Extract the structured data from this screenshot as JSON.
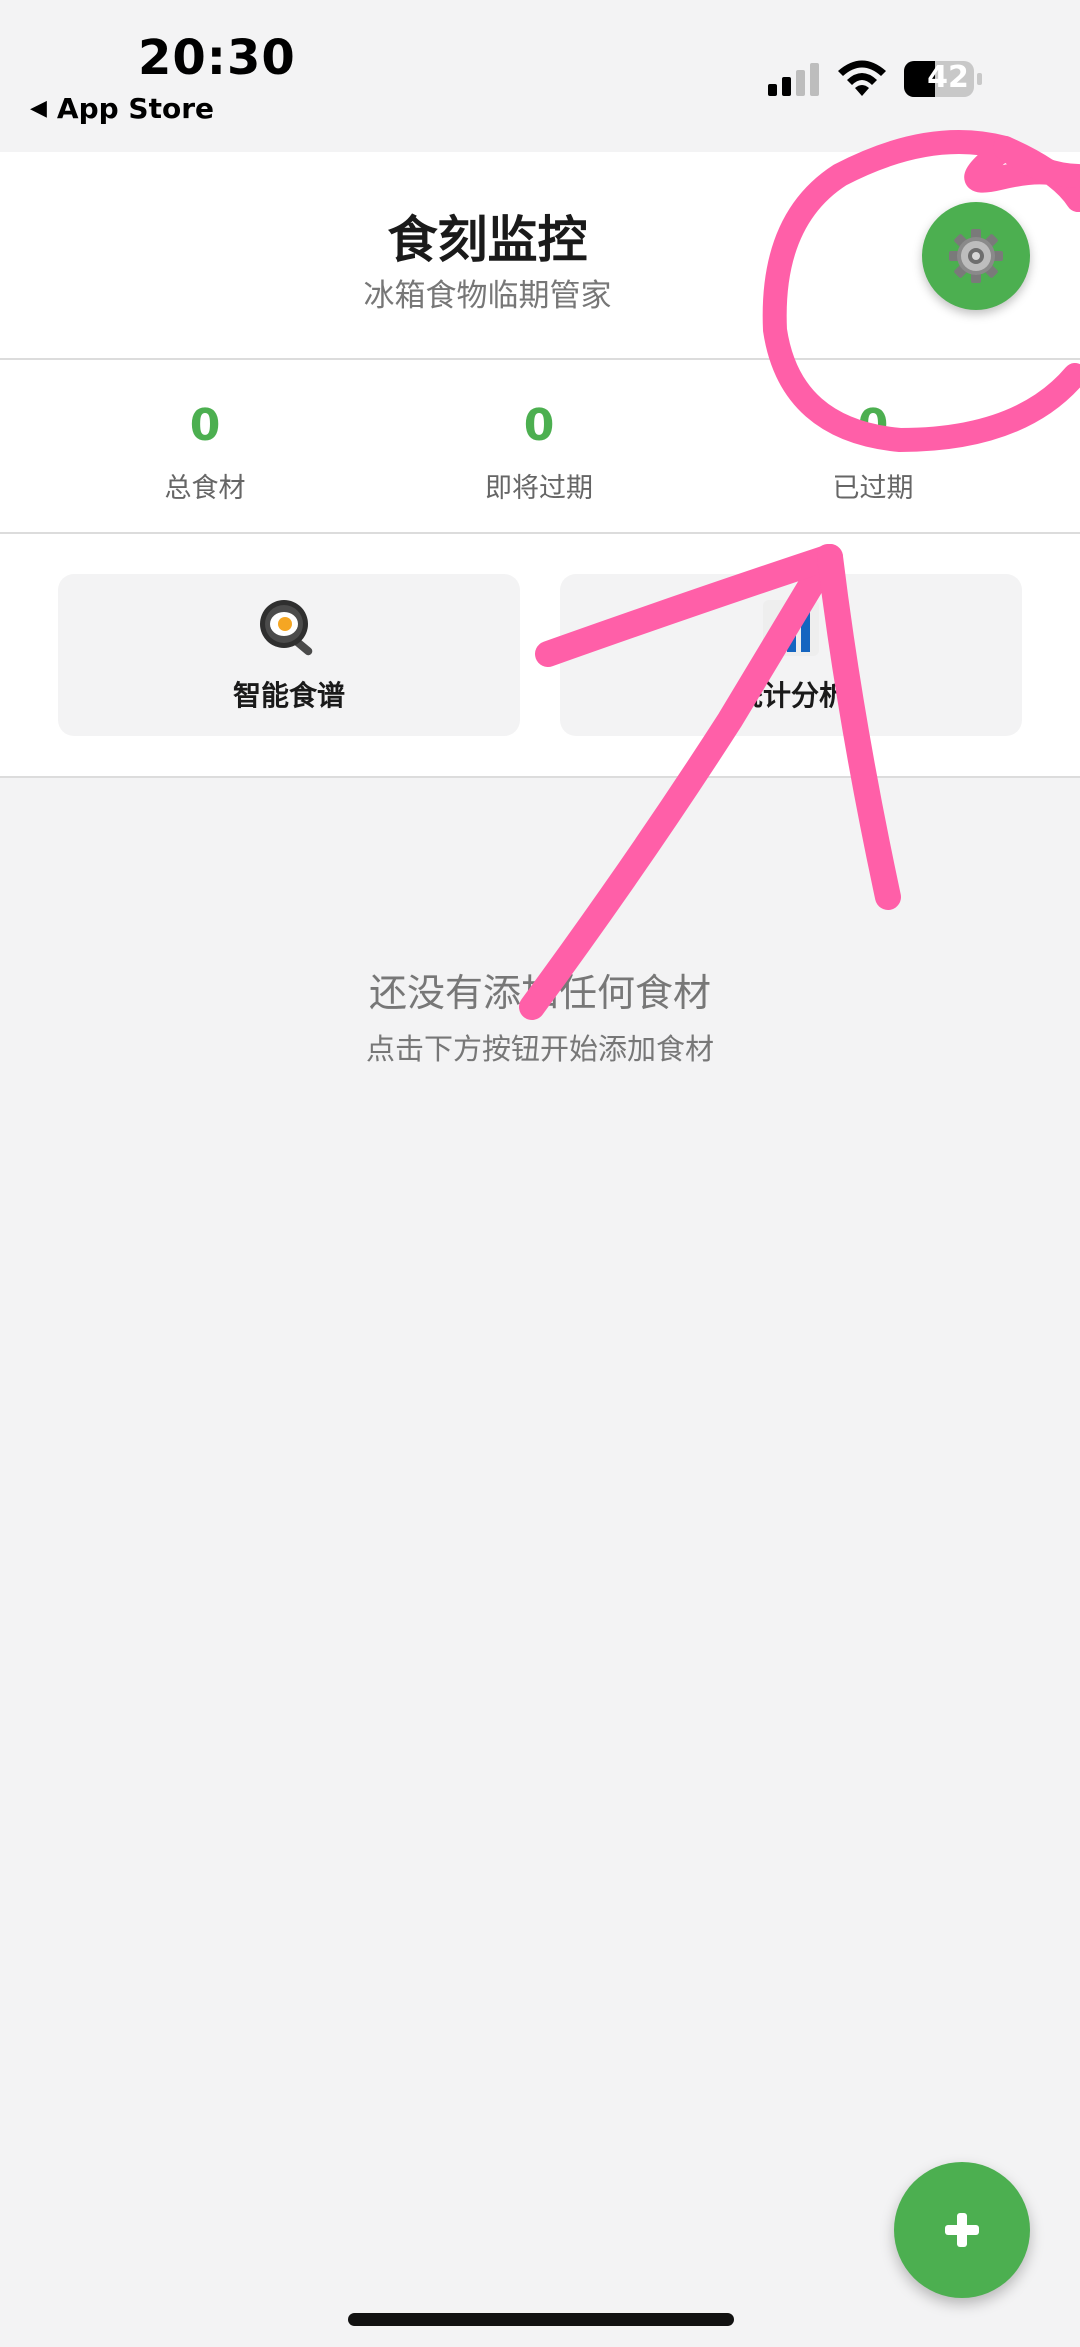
{
  "status_bar": {
    "time": "20:30",
    "back_label": "App Store",
    "battery_level": "42"
  },
  "header": {
    "title": "食刻监控",
    "subtitle": "冰箱食物临期管家",
    "settings_icon": "gear-icon"
  },
  "stats": [
    {
      "value": "0",
      "label": "总食材"
    },
    {
      "value": "0",
      "label": "即将过期"
    },
    {
      "value": "0",
      "label": "已过期"
    }
  ],
  "actions": [
    {
      "label": "智能食谱",
      "icon": "frying-pan-icon"
    },
    {
      "label": "统计分析",
      "icon": "bar-chart-icon"
    }
  ],
  "empty_state": {
    "title": "还没有添加任何食材",
    "hint": "点击下方按钮开始添加食材"
  },
  "fab": {
    "icon": "plus-icon"
  },
  "colors": {
    "accent": "#4caf50",
    "background": "#f3f3f4",
    "annotation": "#ff5fa8"
  }
}
